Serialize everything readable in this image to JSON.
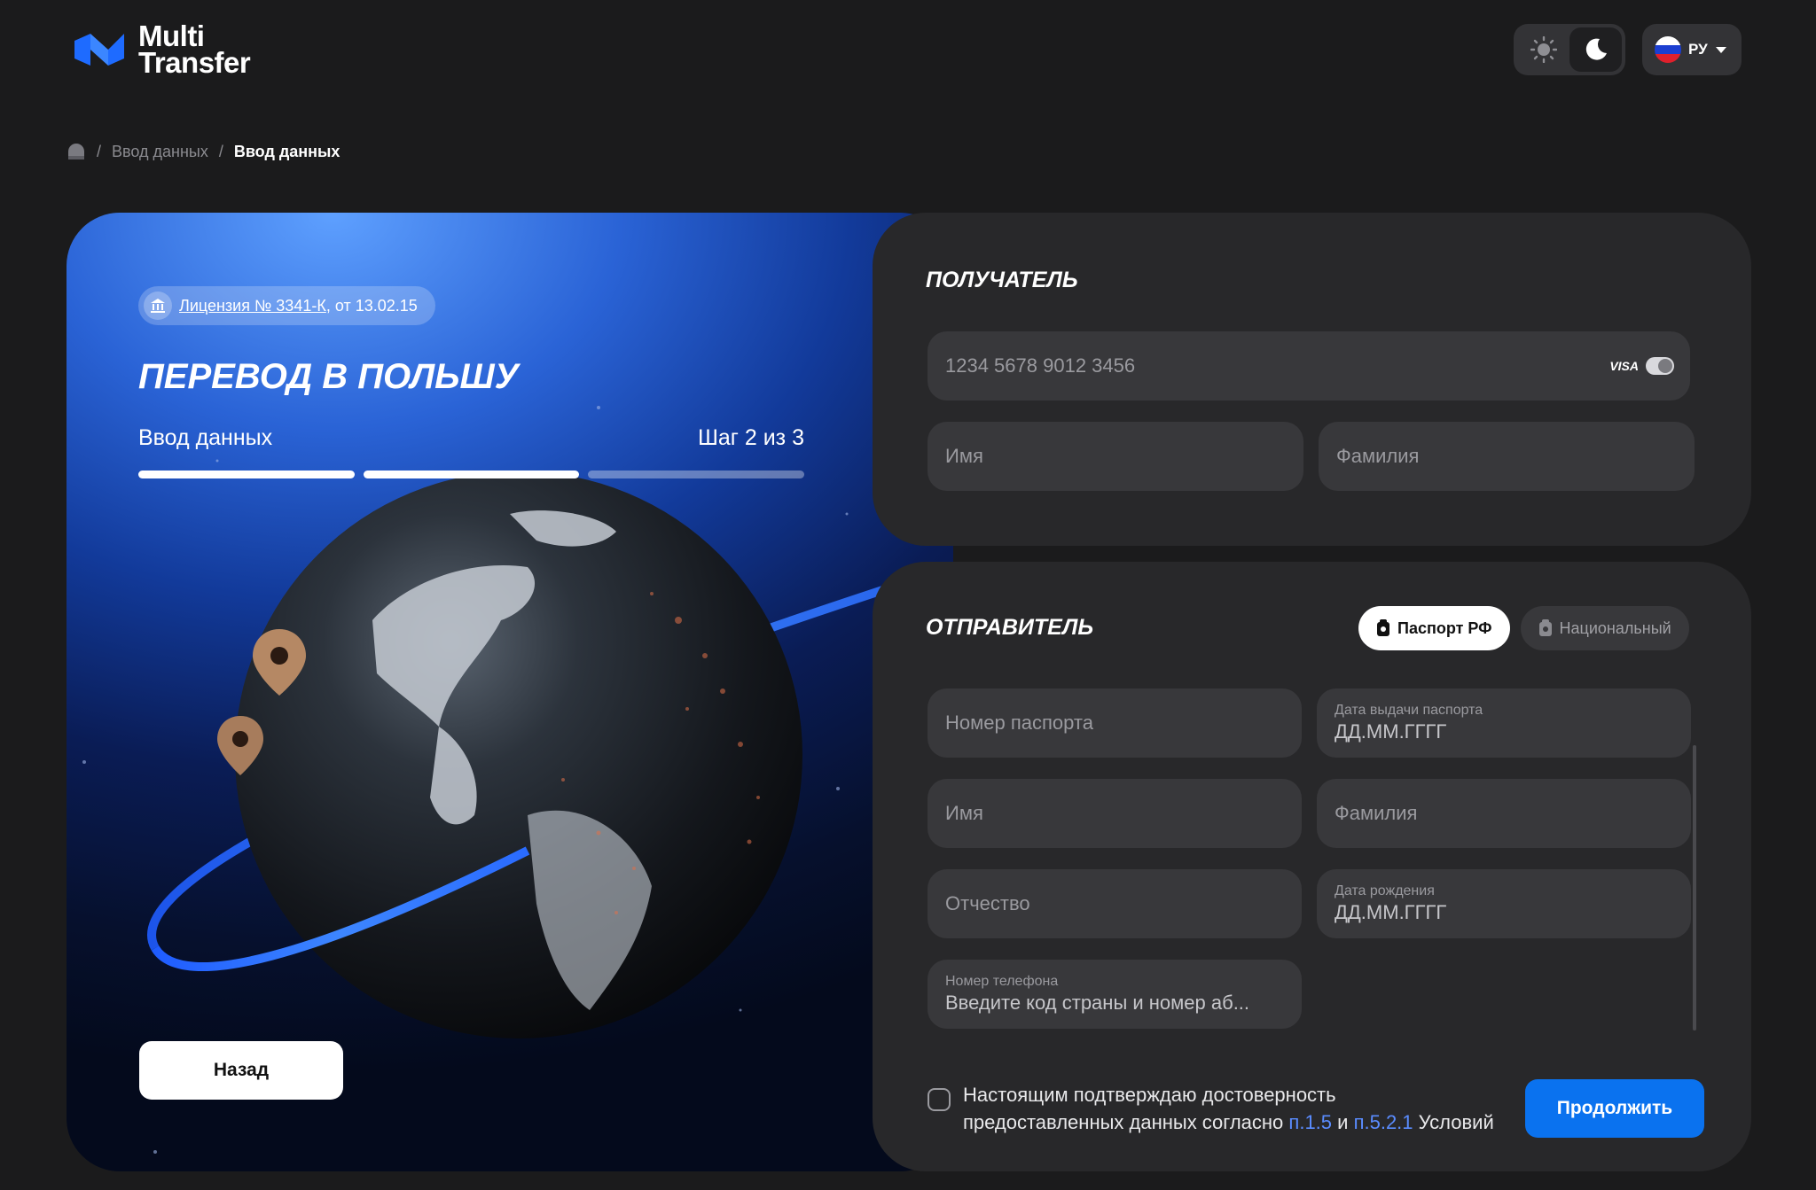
{
  "header": {
    "logo_line1": "Multi",
    "logo_line2": "Transfer",
    "theme_options": [
      "sun-icon",
      "moon-icon"
    ],
    "active_theme": "dark",
    "language": "РУ"
  },
  "breadcrumb": {
    "items": [
      "Ввод данных",
      "Ввод данных"
    ]
  },
  "hero": {
    "license_link": "Лицензия № 3341-К",
    "license_suffix": ", от 13.02.15",
    "title": "ПЕРЕВОД В ПОЛЬШУ",
    "step_label": "Ввод данных",
    "step_count": "Шаг 2 из 3",
    "progress_steps_done": 2,
    "progress_steps_total": 3,
    "back_label": "Назад"
  },
  "recipient": {
    "title": "ПОЛУЧАТЕЛЬ",
    "card_placeholder": "1234 5678 9012 3456",
    "card_brand": "VISA",
    "first_name_placeholder": "Имя",
    "last_name_placeholder": "Фамилия"
  },
  "sender": {
    "title": "ОТПРАВИТЕЛЬ",
    "doc_tabs": [
      "Паспорт РФ",
      "Национальный"
    ],
    "active_doc_tab": "Паспорт РФ",
    "passport_number_placeholder": "Номер паспорта",
    "issue_date_label": "Дата выдачи паспорта",
    "issue_date_placeholder": "ДД.ММ.ГГГГ",
    "first_name_placeholder": "Имя",
    "last_name_placeholder": "Фамилия",
    "patronymic_placeholder": "Отчество",
    "birth_date_label": "Дата рождения",
    "birth_date_placeholder": "ДД.ММ.ГГГГ",
    "phone_label": "Номер телефона",
    "phone_placeholder": "Введите код страны и номер аб..."
  },
  "footer": {
    "consent_line1": "Настоящим подтверждаю достоверность",
    "consent_line2": "предоставленных данных согласно",
    "link1": "п.1.5",
    "and": "и",
    "link2": "п.5.2.1",
    "conditions": "Условий",
    "continue_label": "Продолжить"
  },
  "colors": {
    "background": "#1b1b1c",
    "card": "#28282a",
    "field": "#38383b",
    "accent": "#0a72ef",
    "link": "#5a8cff"
  }
}
